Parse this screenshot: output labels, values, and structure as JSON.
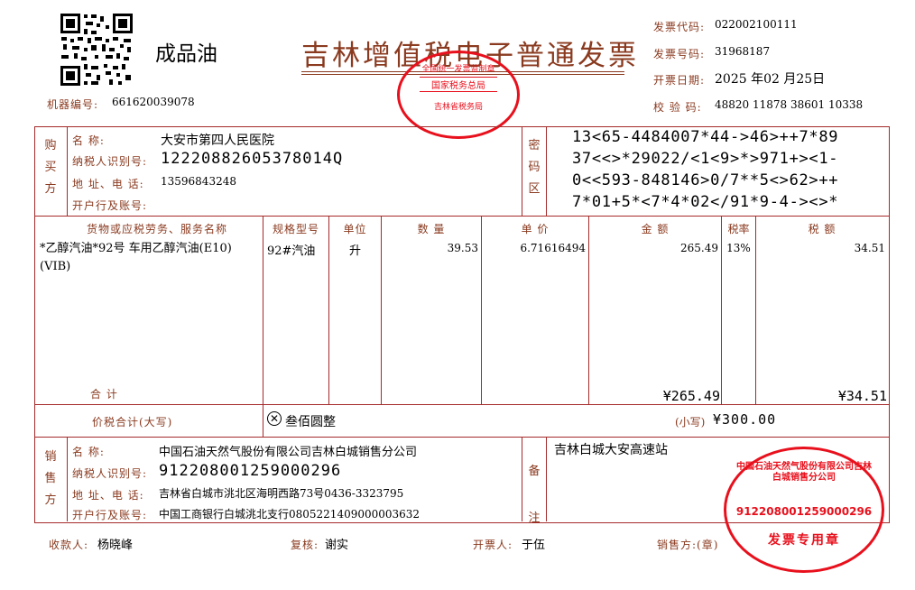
{
  "header": {
    "product_type": "成品油",
    "title": "吉林增值税电子普通发票",
    "machine_no_label": "机器编号:",
    "machine_no": "661620039078",
    "invoice_code_label": "发票代码:",
    "invoice_code": "022002100111",
    "invoice_no_label": "发票号码:",
    "invoice_no": "31968187",
    "date_label": "开票日期:",
    "date": "2025 年02 月25日",
    "check_code_label": "校 验 码:",
    "check_code": "48820 11878 38601 10338"
  },
  "buyer": {
    "section_label": "购买方",
    "name_label": "名      称:",
    "name": "大安市第四人民医院",
    "tax_id_label": "纳税人识别号:",
    "tax_id": "12220882605378014Q",
    "address_label": "地 址、电 话:",
    "address": "13596843248",
    "bank_label": "开户行及账号:",
    "bank": ""
  },
  "cipher": {
    "section_label": "密码区",
    "lines": [
      "13<65-4484007*44->46>++7*89",
      "37<<>*29022/<1<9>*>971+><1-",
      "0<<593-848146>0/7**5<>62>++",
      "7*01+5*<7*4*02</91*9-4-><>*"
    ]
  },
  "items": {
    "headers": {
      "name": "货物或应税劳务、服务名称",
      "spec": "规格型号",
      "unit": "单位",
      "qty": "数  量",
      "price": "单  价",
      "amount": "金  额",
      "rate": "税率",
      "tax": "税  额"
    },
    "rows": [
      {
        "name": "*乙醇汽油*92号 车用乙醇汽油(E10)(VIB)",
        "spec": "92#汽油",
        "unit": "升",
        "qty": "39.53",
        "price": "6.71616494",
        "amount": "265.49",
        "rate": "13%",
        "tax": "34.51"
      }
    ],
    "total_label": "合      计",
    "total_amount": "¥265.49",
    "total_tax": "¥34.51"
  },
  "sum": {
    "label": "价税合计(大写)",
    "words": "叁佰圆整",
    "small_label": "(小写)",
    "small": "¥300.00"
  },
  "seller": {
    "section_label": "销售方",
    "name_label": "名      称:",
    "name": "中国石油天然气股份有限公司吉林白城销售分公司",
    "tax_id_label": "纳税人识别号:",
    "tax_id": "912208001259000296",
    "address_label": "地 址、电 话:",
    "address": "吉林省白城市洮北区海明西路73号0436-3323795",
    "bank_label": "开户行及账号:",
    "bank": "中国工商银行白城洮北支行0805221409000003632"
  },
  "remark": {
    "section_label": "备注",
    "text": "吉林白城大安高速站"
  },
  "footer": {
    "payee_label": "收款人:",
    "payee": "杨晓峰",
    "reviewer_label": "复核:",
    "reviewer": "谢实",
    "drawer_label": "开票人:",
    "drawer": "于伍",
    "seller_label": "销售方:(章)"
  },
  "stamps": {
    "tax_bureau_top": "全国统一发票监制章",
    "tax_bureau_mid": "国家税务总局",
    "tax_bureau_bottom": "吉林省税务局",
    "seller_ring": "中国石油天然气股份有限公司吉林白城销售分公司",
    "seller_tax_id": "912208001259000296",
    "seller_bottom": "发票专用章",
    "color": "#e8101c"
  }
}
